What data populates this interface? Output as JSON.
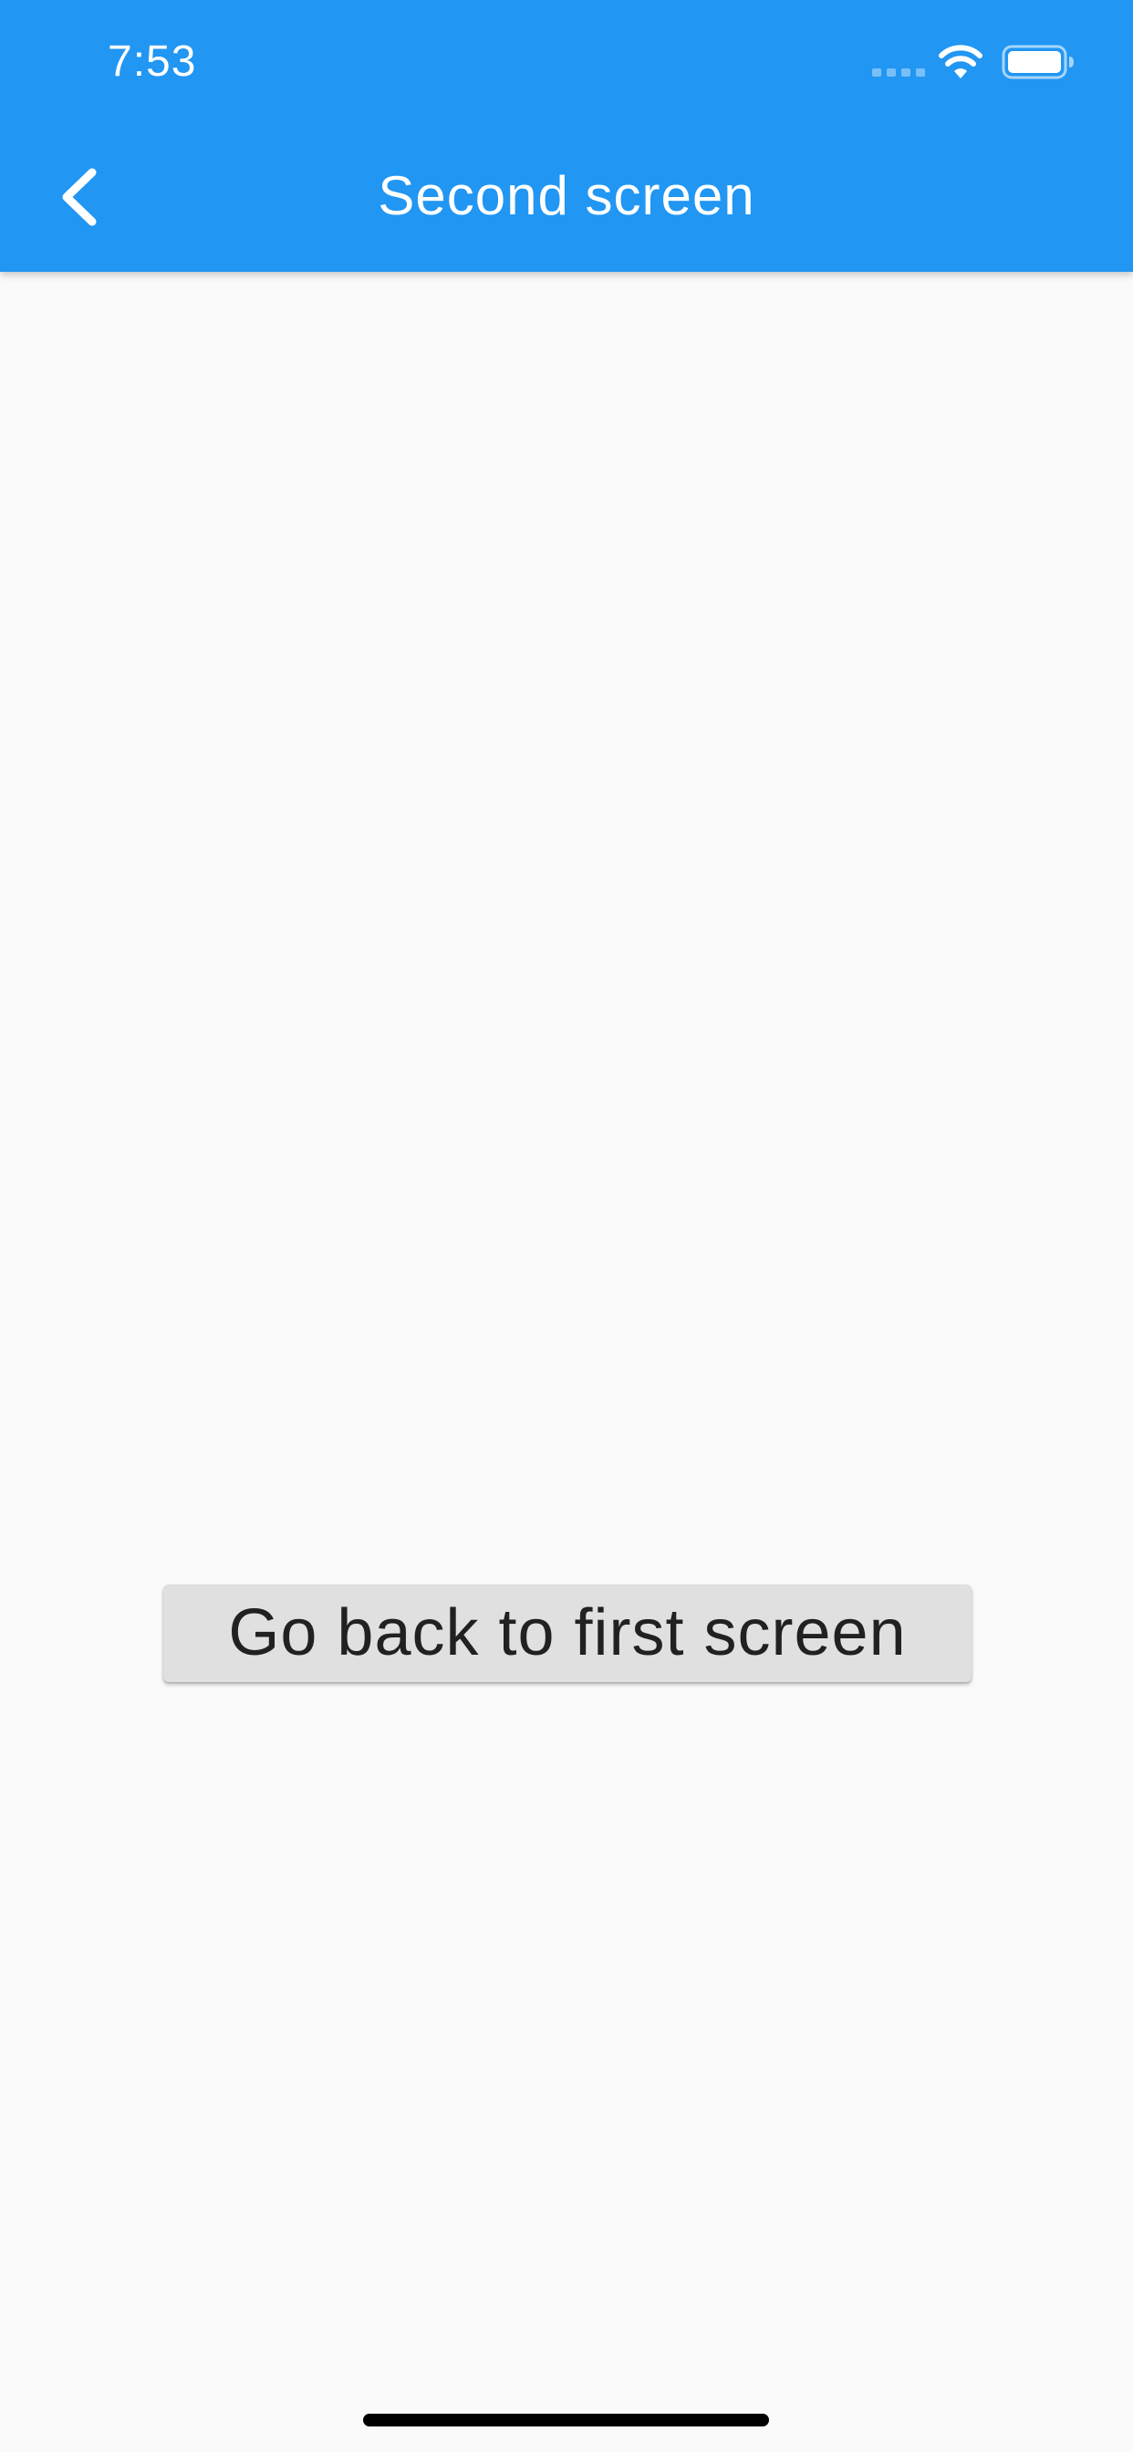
{
  "status_bar": {
    "time": "7:53",
    "icons": [
      "cellular-signal-icon",
      "wifi-icon",
      "battery-icon"
    ]
  },
  "app_bar": {
    "title": "Second screen",
    "back_icon": "chevron-left-icon",
    "background_color": "#2196f3",
    "foreground_color": "#ffffff"
  },
  "main": {
    "button_label": "Go back to first screen",
    "button_background": "#e0e0e0",
    "background_color": "#fafafa"
  }
}
